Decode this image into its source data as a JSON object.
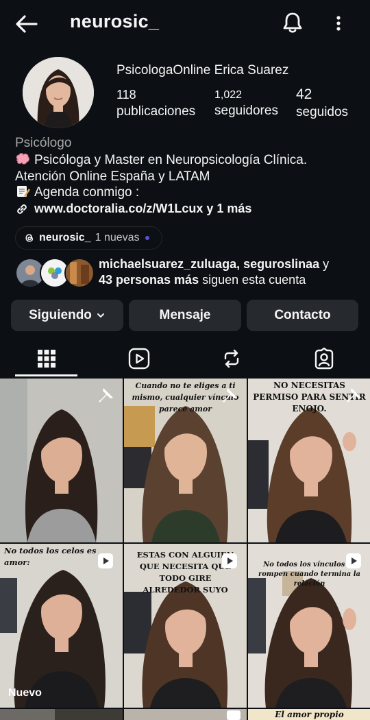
{
  "header": {
    "username": "neurosic_",
    "back_icon": "back-arrow-icon",
    "bell_icon": "bell-icon",
    "more_icon": "more-vertical-icon"
  },
  "profile": {
    "display_name": "PsicologaOnline Erica Suarez",
    "stats": [
      {
        "value": "118",
        "label": "publicaciones"
      },
      {
        "value": "1,022",
        "label": "seguidores"
      },
      {
        "value": "42",
        "label": "seguidos"
      }
    ],
    "category": "Psicólogo",
    "bio_lines": [
      "Psicóloga y Master en Neuropsicología Clínica.",
      "Atención Online España y LATAM",
      "Agenda conmigo :"
    ],
    "link_text": "www.doctoralia.co/z/W1Lcux y 1 más"
  },
  "threads": {
    "handle": "neurosic_",
    "new_label": "1 nuevas"
  },
  "mutuals": {
    "names": "michaelsuarez_zuluaga, seguroslinaa",
    "connector": " y",
    "others": "43 personas más",
    "suffix": " siguen esta cuenta"
  },
  "actions": {
    "following": "Siguiendo",
    "message": "Mensaje",
    "contact": "Contacto"
  },
  "tabs": [
    "grid-icon",
    "reels-icon",
    "reposts-icon",
    "tagged-icon"
  ],
  "posts": [
    {
      "type": "pinned",
      "overlay": ""
    },
    {
      "type": "pinned",
      "overlay": "Cuando no te eliges a ti mismo, cualquier vínculo parece amor"
    },
    {
      "type": "pinned",
      "overlay": "NO NECESITAS PERMISO PARA SENTIR ENOJO."
    },
    {
      "type": "reel",
      "overlay": "No todos los celos es amor:",
      "badge": "Nuevo"
    },
    {
      "type": "reel",
      "overlay": "ESTAS CON ALGUIEN QUE NECESITA QUE TODO GIRE ALREDEDOR SUYO"
    },
    {
      "type": "reel",
      "overlay": "No todos los vínculos se rompen cuando termina la relación"
    }
  ],
  "partial_row": {
    "right_overlay": "El amor propio"
  },
  "colors": {
    "background": "#0c1014",
    "button": "#262a2f",
    "threads_dot": "#5b51d8",
    "muted_text": "#a8a8a8"
  }
}
